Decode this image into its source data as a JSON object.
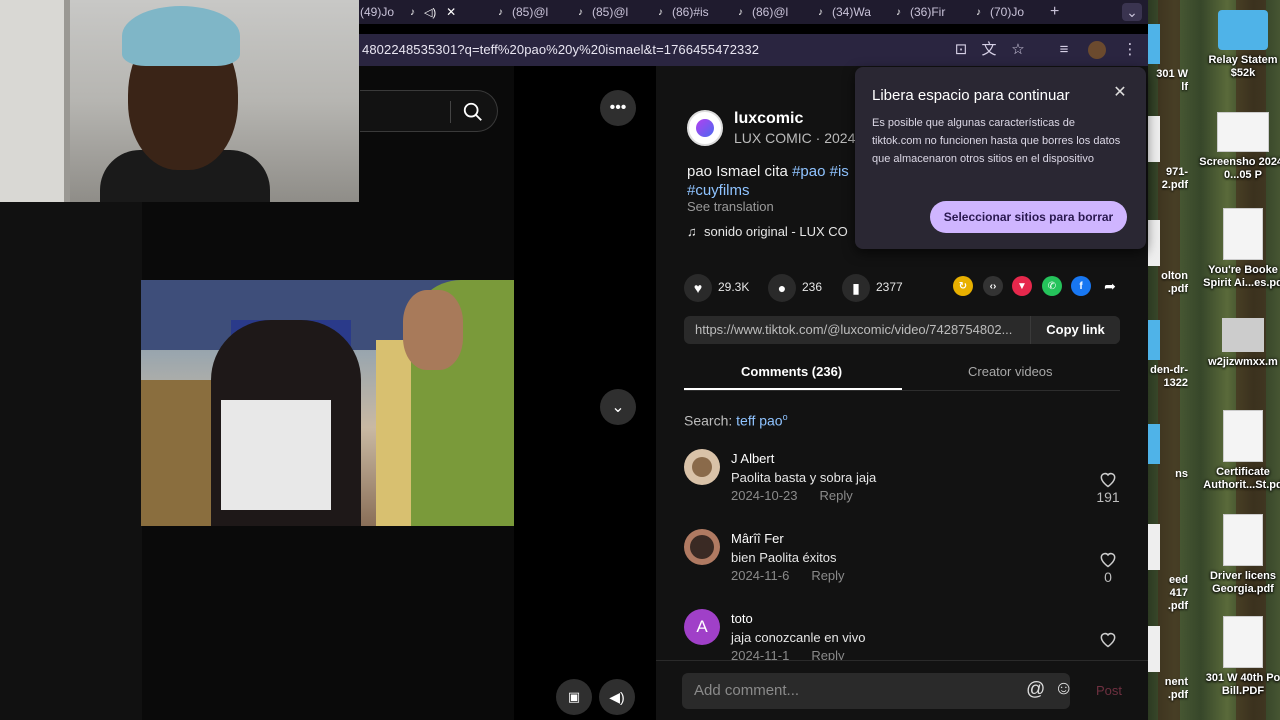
{
  "browser": {
    "tabs": [
      {
        "label": "(49)Jo",
        "active": false
      },
      {
        "label": "",
        "active": true
      },
      {
        "label": "(85)@l",
        "active": false
      },
      {
        "label": "(85)@l",
        "active": false
      },
      {
        "label": "(86)#is",
        "active": false
      },
      {
        "label": "(86)@l",
        "active": false
      },
      {
        "label": "(34)Wa",
        "active": false
      },
      {
        "label": "(36)Fir",
        "active": false
      },
      {
        "label": "(70)Jo",
        "active": false
      }
    ],
    "new_tab_label": "+",
    "tab_menu_label": "⌄",
    "url": "4802248535301?q=teff%20pao%20y%20ismael&t=1766455472332"
  },
  "post": {
    "username": "luxcomic",
    "subline": "LUX COMIC · 2024-1",
    "desc_prefix": "pao Ismael cita ",
    "hashtags": [
      "#pao",
      "#is",
      "#cuyfilms"
    ],
    "see_translation": "See translation",
    "music": "sonido original - LUX CO",
    "likes": "29.3K",
    "comments": "236",
    "saves": "2377",
    "link": "https://www.tiktok.com/@luxcomic/video/7428754802...",
    "copy_link": "Copy link"
  },
  "tabs": {
    "comments": "Comments (236)",
    "creator": "Creator videos"
  },
  "search": {
    "label": "Search: ",
    "query": "teff pao"
  },
  "comments": [
    {
      "name": "J Albert",
      "text": "Paolita basta y sobra jaja",
      "date": "2024-10-23",
      "reply": "Reply",
      "likes": "191",
      "avatar_color": "#d9c2a8"
    },
    {
      "name": "Mârîî Fer",
      "text": "bien Paolita éxitos",
      "date": "2024-11-6",
      "reply": "Reply",
      "likes": "0",
      "avatar_color": "#b07a62"
    },
    {
      "name": "toto",
      "text": "jaja conozcanle en vivo",
      "date": "2024-11-1",
      "reply": "Reply",
      "likes": "",
      "avatar_color": "#a040c8",
      "initial": "A"
    }
  ],
  "comment_bar": {
    "placeholder": "Add comment...",
    "post": "Post"
  },
  "popup": {
    "title": "Libera espacio para continuar",
    "body": "Es posible que algunas características de tiktok.com no funcionen hasta que borres los datos que almacenaron otros sitios en el dispositivo",
    "button": "Seleccionar sitios para borrar"
  },
  "desktop": {
    "icons": [
      {
        "label": "Relay Statem $52k",
        "kind": "folder"
      },
      {
        "label": "Screensho 2024-0...05 P",
        "kind": "doc"
      },
      {
        "label": "You're Booke Spirit Ai...es.pd",
        "kind": "doc"
      },
      {
        "label": "w2jizwmxx.m",
        "kind": "doc"
      },
      {
        "label": "Certificate Authorit...St.pd",
        "kind": "doc"
      },
      {
        "label": "Driver licens Georgia.pdf",
        "kind": "doc"
      },
      {
        "label": "301 W 40th Po Bill.PDF",
        "kind": "doc"
      }
    ],
    "partial": [
      {
        "label": "301 W lf"
      },
      {
        "label": "971- 2.pdf"
      },
      {
        "label": "olton .pdf"
      },
      {
        "label": "den-dr- 1322"
      },
      {
        "label": "ns"
      },
      {
        "label": "eed 417 .pdf"
      },
      {
        "label": "nent .pdf"
      }
    ]
  }
}
